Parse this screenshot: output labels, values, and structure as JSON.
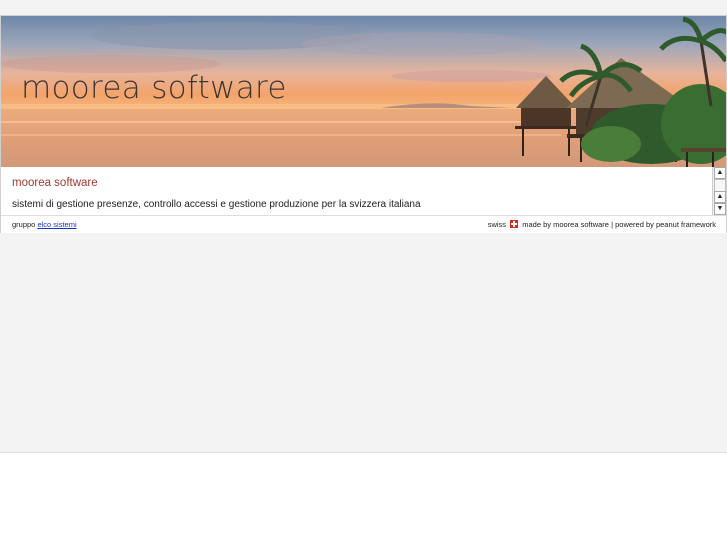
{
  "header": {
    "banner_title": "moorea software"
  },
  "main": {
    "site_name": "moorea software",
    "tagline": "sistemi di gestione presenze, controllo accessi e gestione produzione per la svizzera italiana"
  },
  "scrollbar": {
    "up_arrow": "▲",
    "down_arrow": "▼"
  },
  "footer": {
    "group_prefix": "gruppo",
    "group_link": "elco sistemi",
    "swiss_label": "swiss",
    "made_by": "made by moorea software",
    "separator": "|",
    "powered_by": "powered by peanut framework"
  },
  "colors": {
    "site_name": "#a1392f",
    "link": "#1a33cc",
    "page_background": "#f3f3f3"
  },
  "icons": [
    "swiss-flag-icon",
    "scroll-up-icon",
    "scroll-down-icon"
  ]
}
